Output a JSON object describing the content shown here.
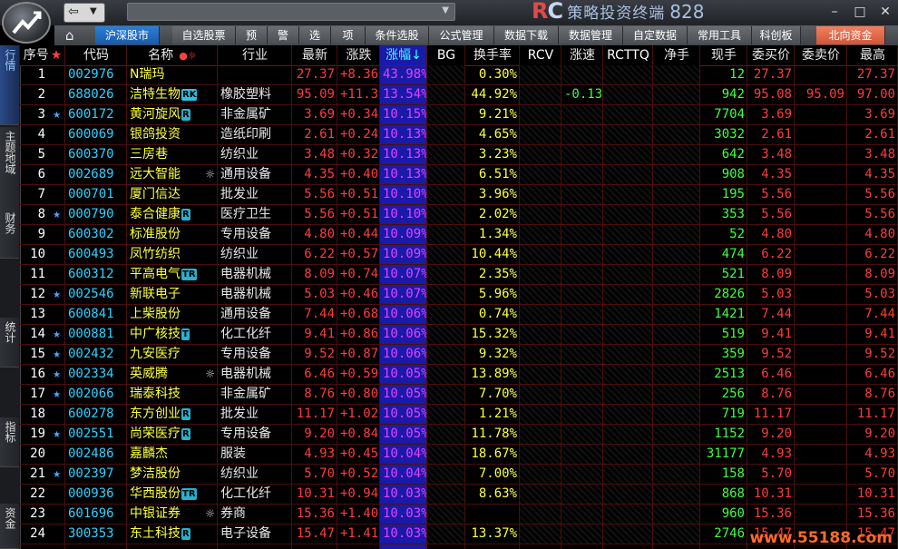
{
  "brand": {
    "rc": "RC",
    "text": "策略投资终端",
    "version": "828"
  },
  "window_buttons": [
    "–",
    "□",
    "✕"
  ],
  "menu": [
    {
      "label": "沪深股市",
      "active": true
    },
    {
      "label": "自选股票"
    },
    {
      "label": "预"
    },
    {
      "label": "警"
    },
    {
      "label": "选"
    },
    {
      "label": "项"
    },
    {
      "label": "条件选股"
    },
    {
      "label": "公式管理"
    },
    {
      "label": "数据下载"
    },
    {
      "label": "数据管理"
    },
    {
      "label": "自定数据"
    },
    {
      "label": "常用工具"
    },
    {
      "label": "科创板"
    },
    {
      "label": "北向资金",
      "north": true
    }
  ],
  "sidebar": [
    {
      "label": "行情",
      "active": true
    },
    {
      "label": "主题地域"
    },
    {
      "label": "财务"
    },
    {
      "label": "统计"
    },
    {
      "label": "指标"
    },
    {
      "label": "资金"
    }
  ],
  "columns": [
    "序号",
    "代码",
    "名称",
    "行业",
    "最新",
    "涨跌",
    "涨幅",
    "BG",
    "换手率",
    "RCV",
    "涨速",
    "RCTTQ",
    "净手",
    "现手",
    "委买价",
    "委卖价",
    "最高"
  ],
  "header_marks": {
    "seq_star": "★",
    "name_dots": "●☼",
    "sort_arrow": "↓"
  },
  "rows": [
    {
      "seq": "1",
      "star": false,
      "code": "002976",
      "name": "N瑞玛",
      "badge": "",
      "gear": false,
      "ind": "",
      "last": "27.37",
      "chg": "+8.36",
      "pct": "43.98%",
      "turn": "0.30%",
      "speed": "",
      "cur": "12",
      "bid": "27.37",
      "ask": "",
      "high": "27.37"
    },
    {
      "seq": "2",
      "star": false,
      "code": "688026",
      "name": "洁特生物",
      "badge": "RK",
      "gear": false,
      "ind": "橡胶塑料",
      "last": "95.09",
      "chg": "+11.34",
      "pct": "13.54%",
      "turn": "44.92%",
      "speed": "-0.13%",
      "cur": "942",
      "bid": "95.08",
      "ask": "95.09",
      "high": "97.00"
    },
    {
      "seq": "3",
      "star": true,
      "code": "600172",
      "name": "黄河旋风",
      "badge": "R",
      "gear": false,
      "ind": "非金属矿",
      "last": "3.69",
      "chg": "+0.34",
      "pct": "10.15%",
      "turn": "9.21%",
      "speed": "",
      "cur": "7704",
      "bid": "3.69",
      "ask": "",
      "high": "3.69"
    },
    {
      "seq": "4",
      "star": false,
      "code": "600069",
      "name": "银鸽投资",
      "badge": "",
      "gear": false,
      "ind": "造纸印刷",
      "last": "2.61",
      "chg": "+0.24",
      "pct": "10.13%",
      "turn": "4.65%",
      "speed": "",
      "cur": "3032",
      "bid": "2.61",
      "ask": "",
      "high": "2.61"
    },
    {
      "seq": "5",
      "star": false,
      "code": "600370",
      "name": "三房巷",
      "badge": "",
      "gear": false,
      "ind": "纺织业",
      "last": "3.48",
      "chg": "+0.32",
      "pct": "10.13%",
      "turn": "3.23%",
      "speed": "",
      "cur": "642",
      "bid": "3.48",
      "ask": "",
      "high": "3.48"
    },
    {
      "seq": "6",
      "star": false,
      "code": "002689",
      "name": "远大智能",
      "badge": "",
      "gear": true,
      "ind": "通用设备",
      "last": "4.35",
      "chg": "+0.40",
      "pct": "10.13%",
      "turn": "6.51%",
      "speed": "",
      "cur": "908",
      "bid": "4.35",
      "ask": "",
      "high": "4.35"
    },
    {
      "seq": "7",
      "star": false,
      "code": "000701",
      "name": "厦门信达",
      "badge": "",
      "gear": false,
      "ind": "批发业",
      "last": "5.56",
      "chg": "+0.51",
      "pct": "10.10%",
      "turn": "3.96%",
      "speed": "",
      "cur": "195",
      "bid": "5.56",
      "ask": "",
      "high": "5.56"
    },
    {
      "seq": "8",
      "star": true,
      "code": "000790",
      "name": "泰合健康",
      "badge": "R",
      "gear": false,
      "ind": "医疗卫生",
      "last": "5.56",
      "chg": "+0.51",
      "pct": "10.10%",
      "turn": "2.02%",
      "speed": "",
      "cur": "353",
      "bid": "5.56",
      "ask": "",
      "high": "5.56"
    },
    {
      "seq": "9",
      "star": false,
      "code": "600302",
      "name": "标准股份",
      "badge": "",
      "gear": false,
      "ind": "专用设备",
      "last": "4.80",
      "chg": "+0.44",
      "pct": "10.09%",
      "turn": "1.34%",
      "speed": "",
      "cur": "52",
      "bid": "4.80",
      "ask": "",
      "high": "4.80"
    },
    {
      "seq": "10",
      "star": false,
      "code": "600493",
      "name": "凤竹纺织",
      "badge": "",
      "gear": false,
      "ind": "纺织业",
      "last": "6.22",
      "chg": "+0.57",
      "pct": "10.09%",
      "turn": "10.44%",
      "speed": "",
      "cur": "474",
      "bid": "6.22",
      "ask": "",
      "high": "6.22"
    },
    {
      "seq": "11",
      "star": false,
      "code": "600312",
      "name": "平高电气",
      "badge": "TR",
      "gear": false,
      "ind": "电器机械",
      "last": "8.09",
      "chg": "+0.74",
      "pct": "10.07%",
      "turn": "2.35%",
      "speed": "",
      "cur": "521",
      "bid": "8.09",
      "ask": "",
      "high": "8.09"
    },
    {
      "seq": "12",
      "star": true,
      "code": "002546",
      "name": "新联电子",
      "badge": "",
      "gear": false,
      "ind": "电器机械",
      "last": "5.03",
      "chg": "+0.46",
      "pct": "10.07%",
      "turn": "5.96%",
      "speed": "",
      "cur": "2826",
      "bid": "5.03",
      "ask": "",
      "high": "5.03"
    },
    {
      "seq": "13",
      "star": false,
      "code": "600841",
      "name": "上柴股份",
      "badge": "",
      "gear": false,
      "ind": "通用设备",
      "last": "7.44",
      "chg": "+0.68",
      "pct": "10.06%",
      "turn": "0.74%",
      "speed": "",
      "cur": "1421",
      "bid": "7.44",
      "ask": "",
      "high": "7.44"
    },
    {
      "seq": "14",
      "star": true,
      "code": "000881",
      "name": "中广核技",
      "badge": "T",
      "gear": false,
      "ind": "化工化纤",
      "last": "9.41",
      "chg": "+0.86",
      "pct": "10.06%",
      "turn": "15.32%",
      "speed": "",
      "cur": "519",
      "bid": "9.41",
      "ask": "",
      "high": "9.41"
    },
    {
      "seq": "15",
      "star": true,
      "code": "002432",
      "name": "九安医疗",
      "badge": "",
      "gear": false,
      "ind": "专用设备",
      "last": "9.52",
      "chg": "+0.87",
      "pct": "10.06%",
      "turn": "9.32%",
      "speed": "",
      "cur": "359",
      "bid": "9.52",
      "ask": "",
      "high": "9.52"
    },
    {
      "seq": "16",
      "star": true,
      "code": "002334",
      "name": "英威腾",
      "badge": "",
      "gear": true,
      "ind": "电器机械",
      "last": "6.46",
      "chg": "+0.59",
      "pct": "10.05%",
      "turn": "13.89%",
      "speed": "",
      "cur": "2513",
      "bid": "6.46",
      "ask": "",
      "high": "6.46"
    },
    {
      "seq": "17",
      "star": true,
      "code": "002066",
      "name": "瑞泰科技",
      "badge": "",
      "gear": false,
      "ind": "非金属矿",
      "last": "8.76",
      "chg": "+0.80",
      "pct": "10.05%",
      "turn": "7.70%",
      "speed": "",
      "cur": "256",
      "bid": "8.76",
      "ask": "",
      "high": "8.76"
    },
    {
      "seq": "18",
      "star": false,
      "code": "600278",
      "name": "东方创业",
      "badge": "R",
      "gear": false,
      "ind": "批发业",
      "last": "11.17",
      "chg": "+1.02",
      "pct": "10.05%",
      "turn": "1.21%",
      "speed": "",
      "cur": "719",
      "bid": "11.17",
      "ask": "",
      "high": "11.17"
    },
    {
      "seq": "19",
      "star": true,
      "code": "002551",
      "name": "尚荣医疗",
      "badge": "R",
      "gear": false,
      "ind": "专用设备",
      "last": "9.20",
      "chg": "+0.84",
      "pct": "10.05%",
      "turn": "11.78%",
      "speed": "",
      "cur": "1152",
      "bid": "9.20",
      "ask": "",
      "high": "9.20"
    },
    {
      "seq": "20",
      "star": false,
      "code": "002486",
      "name": "嘉麟杰",
      "badge": "",
      "gear": false,
      "ind": "服装",
      "last": "4.93",
      "chg": "+0.45",
      "pct": "10.04%",
      "turn": "18.67%",
      "speed": "",
      "cur": "31177",
      "bid": "4.93",
      "ask": "",
      "high": "4.93"
    },
    {
      "seq": "21",
      "star": true,
      "code": "002397",
      "name": "梦洁股份",
      "badge": "",
      "gear": false,
      "ind": "纺织业",
      "last": "5.70",
      "chg": "+0.52",
      "pct": "10.04%",
      "turn": "7.00%",
      "speed": "",
      "cur": "158",
      "bid": "5.70",
      "ask": "",
      "high": "5.70"
    },
    {
      "seq": "22",
      "star": false,
      "code": "000936",
      "name": "华西股份",
      "badge": "TR",
      "gear": false,
      "ind": "化工化纤",
      "last": "10.31",
      "chg": "+0.94",
      "pct": "10.03%",
      "turn": "8.63%",
      "speed": "",
      "cur": "868",
      "bid": "10.31",
      "ask": "",
      "high": "10.31"
    },
    {
      "seq": "23",
      "star": false,
      "code": "601696",
      "name": "中银证券",
      "badge": "",
      "gear": true,
      "ind": "券商",
      "last": "15.36",
      "chg": "+1.40",
      "pct": "10.03%",
      "turn": "",
      "speed": "",
      "cur": "960",
      "bid": "15.36",
      "ask": "",
      "high": "15.36"
    },
    {
      "seq": "24",
      "star": false,
      "code": "300353",
      "name": "东土科技",
      "badge": "R",
      "gear": false,
      "ind": "电子设备",
      "last": "15.47",
      "chg": "+1.41",
      "pct": "10.03%",
      "turn": "13.37%",
      "speed": "",
      "cur": "2746",
      "bid": "15.47",
      "ask": "",
      "high": "15.47"
    }
  ],
  "watermark": "www.55188.com",
  "colors": {
    "red": "#ff3b3b",
    "yellow": "#ffff40",
    "cyan": "#30d0ff",
    "green": "#40ff40",
    "magenta": "#e040ff",
    "white": "#ffffff"
  }
}
